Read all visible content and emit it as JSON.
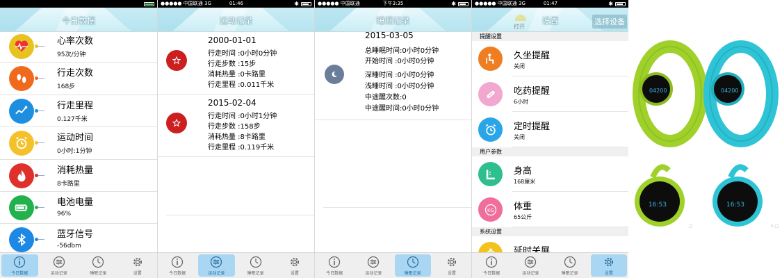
{
  "screens": [
    {
      "status": {
        "carrier": "",
        "time": "",
        "battery": ""
      },
      "title": "今日数据",
      "items": [
        {
          "label": "心率次数",
          "value": "95次/分钟",
          "icon": "heart-rate-icon",
          "color": "#e8c21f"
        },
        {
          "label": "行走次数",
          "value": "168步",
          "icon": "footprints-icon",
          "color": "#ef6a1c"
        },
        {
          "label": "行走里程",
          "value": "0.127千米",
          "icon": "distance-graph-icon",
          "color": "#1e8fe0"
        },
        {
          "label": "运动时间",
          "value": "0小时:1分钟",
          "icon": "alarm-clock-icon",
          "color": "#f5c12a"
        },
        {
          "label": "消耗热量",
          "value": "8卡路里",
          "icon": "flame-icon",
          "color": "#e0302c"
        },
        {
          "label": "电池电量",
          "value": "96%",
          "icon": "battery-icon",
          "color": "#22b14c"
        },
        {
          "label": "蓝牙信号",
          "value": "-56dbm",
          "icon": "bluetooth-icon",
          "color": "#1e88e5"
        }
      ]
    },
    {
      "status": {
        "carrier": "●●●●● 中国联通  3G",
        "time": "01:46",
        "battery": ""
      },
      "title": "运动记录",
      "records": [
        {
          "date": "2000-01-01",
          "lines": [
            "行走时间 :0小时0分钟",
            "行走步数 :15步",
            "消耗热量 :0卡路里",
            "行走里程 :0.011千米"
          ]
        },
        {
          "date": "2015-02-04",
          "lines": [
            "行走时间 :0小时1分钟",
            "行走步数 :158步",
            "消耗热量 :8卡路里",
            "行走里程 :0.119千米"
          ]
        }
      ]
    },
    {
      "status": {
        "carrier": "●●●●● 中国联通",
        "time": "下午3:35",
        "battery": ""
      },
      "title": "睡眠记录",
      "records": [
        {
          "date": "2015-03-05",
          "lines": [
            "总睡眠时间:0小时0分钟",
            "开始时间 :0小时0分钟",
            "深睡时间 :0小时0分钟",
            "浅睡时间 :0小时0分钟",
            "中途醒次数:0",
            "中途醒时间:0小时0分钟"
          ]
        }
      ]
    },
    {
      "status": {
        "carrier": "●●●●● 中国联通  3G",
        "time": "01:47",
        "battery": ""
      },
      "title": "设置",
      "action": "选择设备",
      "ghost": "打开",
      "sections": [
        {
          "header": "提醒设置",
          "items": [
            {
              "label": "久坐提醒",
              "value": "关闭",
              "icon": "sitting-person-icon",
              "color": "#ef7d22"
            },
            {
              "label": "吃药提醒",
              "value": "6小时",
              "icon": "pill-icon",
              "color": "#f2a7d0"
            },
            {
              "label": "定时提醒",
              "value": "关闭",
              "icon": "alarm-clock-icon",
              "color": "#2aa6e8"
            }
          ]
        },
        {
          "header": "用户参数",
          "items": [
            {
              "label": "身高",
              "value": "168厘米",
              "icon": "ruler-icon",
              "color": "#2fbf8f"
            },
            {
              "label": "体重",
              "value": "65公斤",
              "icon": "kg-weight-icon",
              "color": "#ef6e9c"
            }
          ]
        },
        {
          "header": "系统设置",
          "items": [
            {
              "label": "延时关屏",
              "value": "",
              "icon": "timer-icon",
              "color": "#f3c21b"
            }
          ]
        }
      ]
    }
  ],
  "tabs": [
    {
      "label": "今日数据",
      "icon": "info-icon"
    },
    {
      "label": "运动记录",
      "icon": "sliders-icon"
    },
    {
      "label": "睡眠记录",
      "icon": "clock-icon"
    },
    {
      "label": "设置",
      "icon": "gear-icon"
    }
  ],
  "product": {
    "watermarks": [
      "□",
      "n □"
    ],
    "band_1_display": "04200",
    "band_2_display": "04200",
    "pendant_1_display": "16:53",
    "pendant_2_display": "16:53",
    "colors": {
      "lime": "#9fd12a",
      "cyan": "#2ec4d6"
    }
  }
}
